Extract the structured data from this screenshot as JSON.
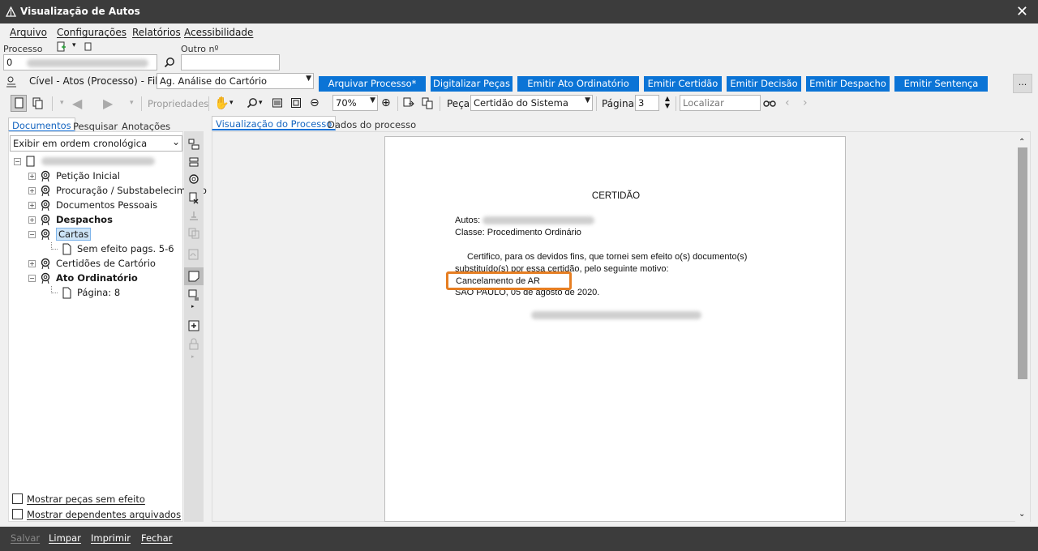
{
  "window": {
    "title": "Visualização de Autos",
    "close_glyph": "✕"
  },
  "menu": [
    "Arquivo",
    "Configurações",
    "Relatórios",
    "Acessibilidade"
  ],
  "header": {
    "processo_label": "Processo",
    "processo_value": "0",
    "outro_label": "Outro nº",
    "outro_value": ""
  },
  "fila": {
    "label": "Cível - Atos (Processo) - Fila:",
    "selected": "Ag. Análise do Cartório"
  },
  "actions": [
    "Arquivar Processo*",
    "Digitalizar Peças",
    "Emitir Ato Ordinatório",
    "Emitir Certidão",
    "Emitir Decisão",
    "Emitir Despacho",
    "Emitir Sentença"
  ],
  "more_button": "...",
  "toolbar": {
    "propriedades": "Propriedades",
    "zoom": "70%",
    "peca_label": "Peça",
    "peca_value": "Certidão do Sistema",
    "pagina_label": "Página",
    "pagina_value": "3",
    "localizar_placeholder": "Localizar"
  },
  "left_tabs": [
    "Documentos",
    "Pesquisar",
    "Anotações"
  ],
  "order_select": "Exibir em ordem cronológica",
  "tree": [
    {
      "label": "Petição Inicial",
      "bold": false
    },
    {
      "label": "Procuração / Substabelecimento",
      "bold": false
    },
    {
      "label": "Documentos Pessoais",
      "bold": false
    },
    {
      "label": "Despachos",
      "bold": true
    },
    {
      "label": "Cartas",
      "bold": false,
      "selected": true
    },
    {
      "label": "Sem efeito pags. 5-6",
      "bold": false,
      "child": true
    },
    {
      "label": "Certidões de Cartório",
      "bold": false
    },
    {
      "label": "Ato Ordinatório",
      "bold": true
    },
    {
      "label": "Página: 8",
      "bold": false,
      "child": true
    }
  ],
  "checkboxes": [
    "Mostrar peças sem efeito",
    "Mostrar dependentes arquivados"
  ],
  "viewer_tabs": [
    "Visualização do Processo",
    "Dados do processo"
  ],
  "document": {
    "title": "CERTIDÃO",
    "autos_label": "Autos:",
    "classe": "Classe: Procedimento Ordinário",
    "body_line1": "Certifico, para os devidos fins, que tornei sem efeito o(s) documento(s)",
    "body_line2": "substituído(s) por essa certidão, pelo seguinte motivo:",
    "motivo": "Cancelamento de AR",
    "date_line": "SÃO PAULO, 05 de agosto de 2020."
  },
  "status": [
    "Salvar",
    "Limpar",
    "Imprimir",
    "Fechar"
  ],
  "colors": {
    "accent": "#0b74d6",
    "highlight": "#e67e22",
    "titlebar": "#3c3c3c"
  }
}
